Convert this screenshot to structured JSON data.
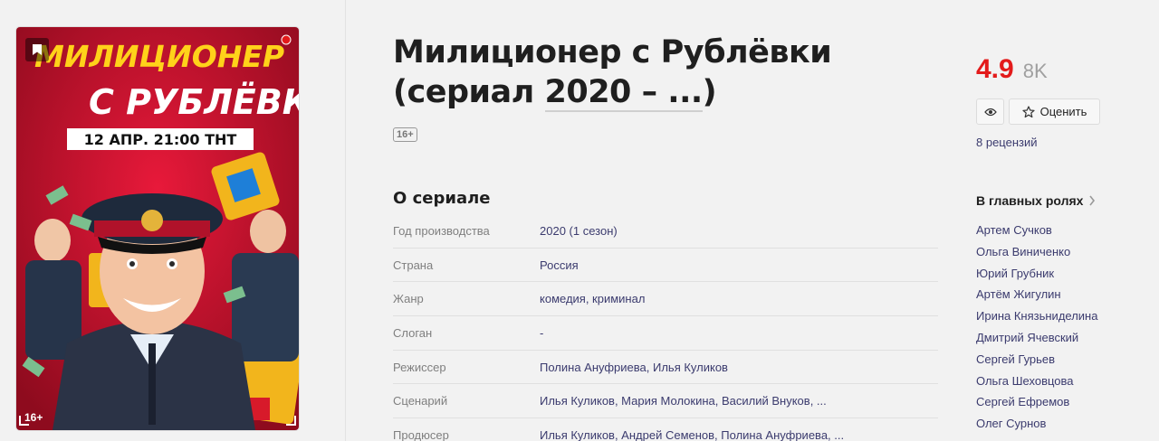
{
  "poster": {
    "title_line1": "МИЛИЦИОНЕР",
    "title_line2": "С РУБЛЁВКИ",
    "air_banner": "12 АПР. 21:00 ТНТ",
    "age": "16+"
  },
  "film": {
    "title_main": "Милиционер с Рублёвки",
    "title_prefix": "(сериал ",
    "title_years": "2020 – ...",
    "title_suffix": ")",
    "age_rating": "16+"
  },
  "about": {
    "heading": "О сериале",
    "rows": [
      {
        "label": "Год производства",
        "value": "2020 (1 сезон)"
      },
      {
        "label": "Страна",
        "value": "Россия"
      },
      {
        "label": "Жанр",
        "value": "комедия, криминал"
      },
      {
        "label": "Слоган",
        "value": "-"
      },
      {
        "label": "Режиссер",
        "value": "Полина Ануфриева, Илья Куликов"
      },
      {
        "label": "Сценарий",
        "value": "Илья Куликов, Мария Молокина, Василий Внуков, ..."
      },
      {
        "label": "Продюсер",
        "value": "Илья Куликов, Андрей Семенов, Полина Ануфриева, ..."
      }
    ]
  },
  "rating": {
    "value": "4.9",
    "count": "8K",
    "rate_label": "Оценить",
    "reviews": "8 рецензий"
  },
  "cast": {
    "heading": "В главных ролях",
    "items": [
      "Артем Сучков",
      "Ольга Виниченко",
      "Юрий Грубник",
      "Артём Жигулин",
      "Ирина Князьниделина",
      "Дмитрий Ячевский",
      "Сергей Гурьев",
      "Ольга Шеховцова",
      "Сергей Ефремов",
      "Олег Сурнов"
    ]
  },
  "colors": {
    "rating": "#e31b1b",
    "link": "#3b3b6e",
    "poster_bg": "#c8102e"
  }
}
